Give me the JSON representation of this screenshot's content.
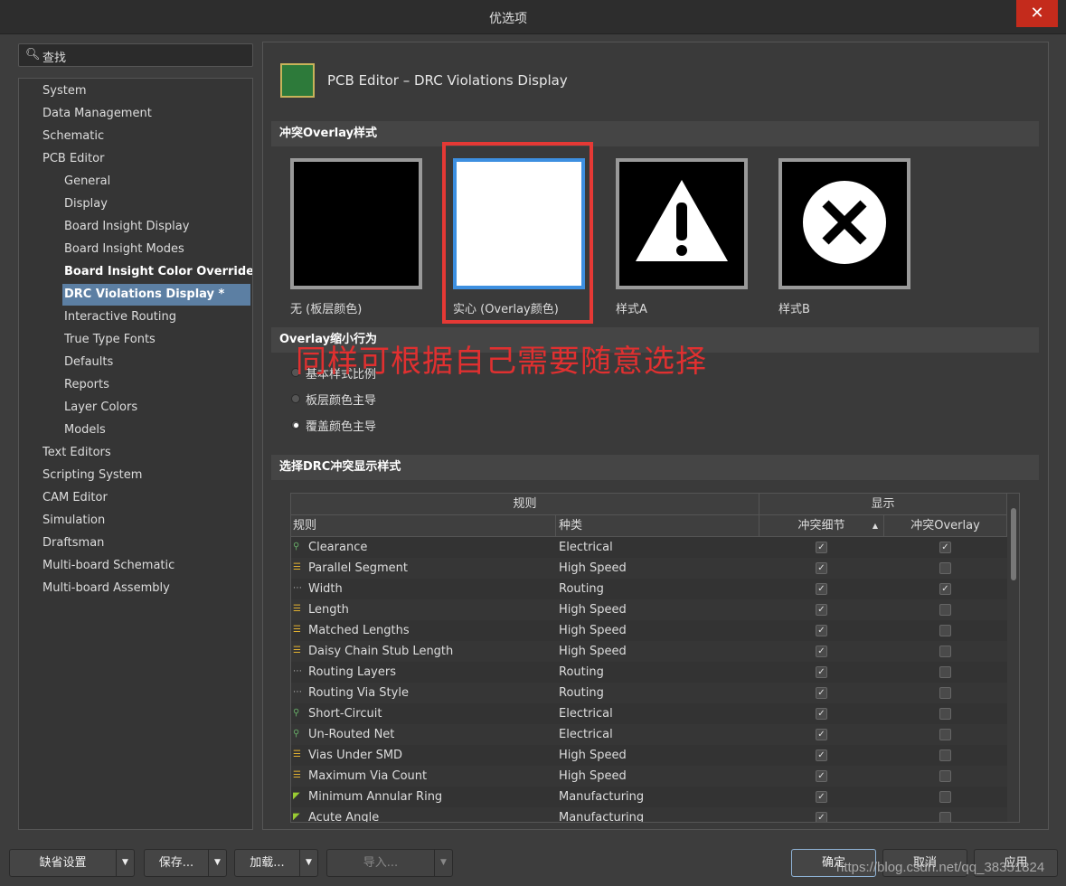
{
  "window": {
    "title": "优选项",
    "close": "✕"
  },
  "search": {
    "placeholder": "查找"
  },
  "tree": [
    {
      "label": "System",
      "level": 0
    },
    {
      "label": "Data Management",
      "level": 0
    },
    {
      "label": "Schematic",
      "level": 0
    },
    {
      "label": "PCB Editor",
      "level": 0,
      "expanded": true
    },
    {
      "label": "General",
      "level": 1
    },
    {
      "label": "Display",
      "level": 1
    },
    {
      "label": "Board Insight Display",
      "level": 1
    },
    {
      "label": "Board Insight Modes",
      "level": 1
    },
    {
      "label": "Board Insight Color Overrides *",
      "level": 1,
      "bold": true
    },
    {
      "label": "DRC Violations Display *",
      "level": 1,
      "selected": true
    },
    {
      "label": "Interactive Routing",
      "level": 1
    },
    {
      "label": "True Type Fonts",
      "level": 1
    },
    {
      "label": "Defaults",
      "level": 1
    },
    {
      "label": "Reports",
      "level": 1
    },
    {
      "label": "Layer Colors",
      "level": 1
    },
    {
      "label": "Models",
      "level": 1
    },
    {
      "label": "Text Editors",
      "level": 0
    },
    {
      "label": "Scripting System",
      "level": 0
    },
    {
      "label": "CAM Editor",
      "level": 0
    },
    {
      "label": "Simulation",
      "level": 0
    },
    {
      "label": "Draftsman",
      "level": 0
    },
    {
      "label": "Multi-board Schematic",
      "level": 0
    },
    {
      "label": "Multi-board Assembly",
      "level": 0
    }
  ],
  "page": {
    "title": "PCB Editor – DRC Violations Display"
  },
  "overlay_style": {
    "heading": "冲突Overlay样式",
    "options": [
      {
        "label": "无 (板层颜色)",
        "style": "none"
      },
      {
        "label": "实心 (Overlay颜色)",
        "style": "solid",
        "selected": true
      },
      {
        "label": "样式A",
        "style": "warning"
      },
      {
        "label": "样式B",
        "style": "cross"
      }
    ]
  },
  "shrink": {
    "heading": "Overlay缩小行为",
    "options": [
      {
        "label": "基本样式比例",
        "checked": false
      },
      {
        "label": "板层颜色主导",
        "checked": false
      },
      {
        "label": "覆盖颜色主导",
        "checked": true
      }
    ]
  },
  "annotation": "同样可根据自己需要随意选择",
  "drc": {
    "heading": "选择DRC冲突显示样式",
    "group_headers": [
      "规则",
      "显示"
    ],
    "columns": [
      "规则",
      "种类",
      "冲突细节",
      "冲突Overlay"
    ],
    "rows": [
      {
        "rule": "Clearance",
        "type": "Electrical",
        "detail": true,
        "overlay": true,
        "icon": "electrical"
      },
      {
        "rule": "Parallel Segment",
        "type": "High Speed",
        "detail": true,
        "overlay": false,
        "icon": "highspeed"
      },
      {
        "rule": "Width",
        "type": "Routing",
        "detail": true,
        "overlay": true,
        "icon": "routing"
      },
      {
        "rule": "Length",
        "type": "High Speed",
        "detail": true,
        "overlay": false,
        "icon": "highspeed"
      },
      {
        "rule": "Matched Lengths",
        "type": "High Speed",
        "detail": true,
        "overlay": false,
        "icon": "highspeed"
      },
      {
        "rule": "Daisy Chain Stub Length",
        "type": "High Speed",
        "detail": true,
        "overlay": false,
        "icon": "highspeed"
      },
      {
        "rule": "Routing Layers",
        "type": "Routing",
        "detail": true,
        "overlay": false,
        "icon": "routing"
      },
      {
        "rule": "Routing Via Style",
        "type": "Routing",
        "detail": true,
        "overlay": false,
        "icon": "routing"
      },
      {
        "rule": "Short-Circuit",
        "type": "Electrical",
        "detail": true,
        "overlay": false,
        "icon": "electrical"
      },
      {
        "rule": "Un-Routed Net",
        "type": "Electrical",
        "detail": true,
        "overlay": false,
        "icon": "electrical"
      },
      {
        "rule": "Vias Under SMD",
        "type": "High Speed",
        "detail": true,
        "overlay": false,
        "icon": "highspeed"
      },
      {
        "rule": "Maximum Via Count",
        "type": "High Speed",
        "detail": true,
        "overlay": false,
        "icon": "highspeed"
      },
      {
        "rule": "Minimum Annular Ring",
        "type": "Manufacturing",
        "detail": true,
        "overlay": false,
        "icon": "manufacturing"
      },
      {
        "rule": "Acute Angle",
        "type": "Manufacturing",
        "detail": true,
        "overlay": false,
        "icon": "manufacturing"
      }
    ]
  },
  "buttons": {
    "defaults": "缺省设置",
    "save": "保存...",
    "load": "加载...",
    "import": "导入...",
    "ok": "确定",
    "cancel": "取消",
    "apply": "应用"
  },
  "watermark": "https://blog.csdn.net/qq_38351824",
  "colors": {
    "accent": "#5c7fa3",
    "annotation": "#e53935",
    "solid_border": "#3d8fe0"
  }
}
